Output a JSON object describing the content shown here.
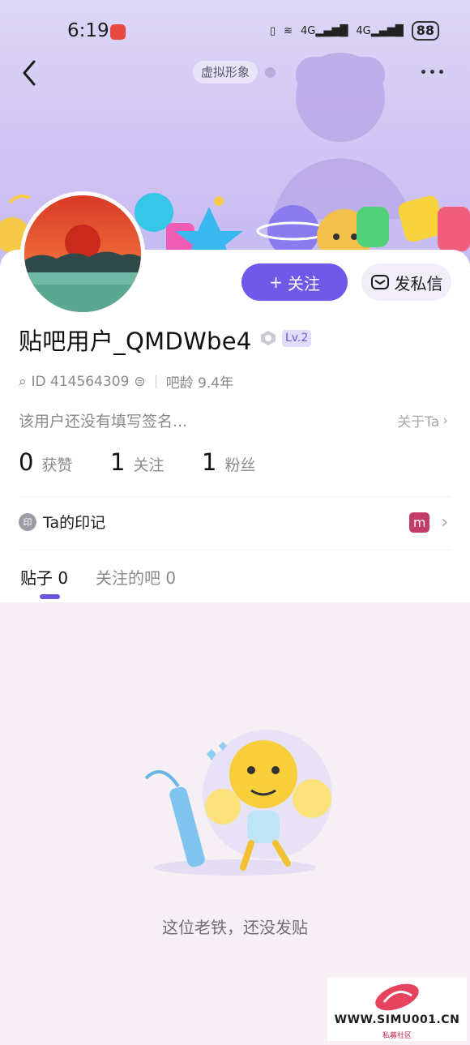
{
  "status_bar": {
    "time": "6:19",
    "battery": "88",
    "net1": "4G",
    "net2": "4G"
  },
  "header": {
    "virtual_tag": "虚拟形象"
  },
  "actions": {
    "follow_label": "关注",
    "follow_prefix": "+",
    "message_label": "发私信"
  },
  "profile": {
    "username": "贴吧用户_QMDWbe4",
    "level": "Lv.2",
    "id_text": "ID 414564309",
    "age_text": "吧龄 9.4年",
    "signature": "该用户还没有填写签名...",
    "about_label": "关于Ta"
  },
  "stats": [
    {
      "value": "0",
      "label": "获赞"
    },
    {
      "value": "1",
      "label": "关注"
    },
    {
      "value": "1",
      "label": "粉丝"
    }
  ],
  "mark_row": {
    "icon_text": "印",
    "label": "Ta的印记",
    "badge_text": "m"
  },
  "tabs": [
    {
      "label": "贴子",
      "count": "0"
    },
    {
      "label": "关注的吧",
      "count": "0"
    }
  ],
  "empty_state": {
    "text": "这位老铁，还没发贴"
  },
  "watermark": {
    "text": "WWW.SIMU001.CN",
    "sub": "私募社区"
  },
  "colors": {
    "accent": "#7058e8",
    "banner": "#d3c8f4",
    "background": "#f6f0f5"
  }
}
